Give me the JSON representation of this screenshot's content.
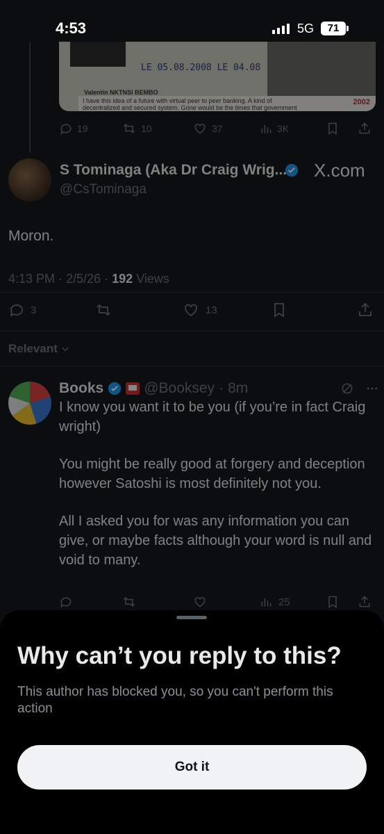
{
  "status_bar": {
    "time": "4:53",
    "network": "5G",
    "battery": "71"
  },
  "quoted_image": {
    "stamp_text": "LE 05.08.2008 LE 04.08",
    "name_text": "Valentin NKTNSI BEMBO",
    "caption": "I have this idea of a future with virtual peer to peer banking. A kind of",
    "caption_line2": "decentralized and secured system. Gone would be the times that government",
    "year": "2002"
  },
  "quoted_stats": {
    "replies": "19",
    "reposts": "10",
    "likes": "37",
    "views": "3K"
  },
  "main_tweet": {
    "author_name": "S Tominaga (Aka Dr Craig Wrig...",
    "handle": "@CsTominaga",
    "source_label": "X.com",
    "text": "Moron.",
    "time": "4:13 PM",
    "date": "2/5/26",
    "views_count": "192",
    "views_label": "Views",
    "replies": "3",
    "likes": "13",
    "separator": "·"
  },
  "filter": {
    "label": "Relevant"
  },
  "reply": {
    "name": "Books",
    "handle": "@Booksey",
    "time": "8m",
    "separator": "·",
    "paragraphs": [
      "I know you want it to be you (if you’re in fact Craig wright)",
      "You might be really good at forgery and deception however Satoshi is most definitely not you.",
      "All I asked you for was any information you can give, or maybe facts although your word is null and void to many."
    ],
    "views": "25"
  },
  "sheet": {
    "title": "Why can’t you reply to this?",
    "description": "This author has blocked you, so you can't perform this action",
    "button_label": "Got it"
  },
  "colors": {
    "background": "#15181c",
    "sheet_background": "#000000",
    "accent_blue": "#1d9bf0",
    "muted_text": "#71767b",
    "button_bg": "#eff3f4"
  },
  "icons": [
    "reply-icon",
    "repost-icon",
    "like-icon",
    "views-icon",
    "bookmark-icon",
    "share-icon",
    "verified-icon",
    "grok-icon",
    "more-icon",
    "chevron-down-icon"
  ]
}
